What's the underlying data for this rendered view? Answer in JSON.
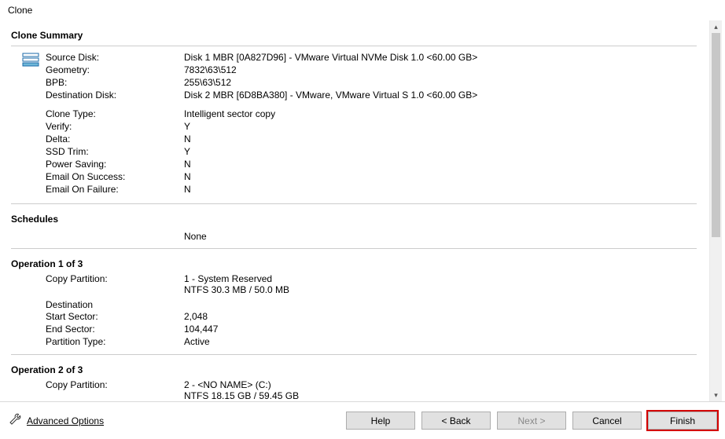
{
  "window": {
    "title": "Clone"
  },
  "summary": {
    "heading": "Clone Summary",
    "rows1": [
      {
        "label": "Source Disk:",
        "value": "Disk 1 MBR [0A827D96] - VMware Virtual NVMe Disk 1.0  <60.00 GB>"
      },
      {
        "label": "Geometry:",
        "value": "7832\\63\\512"
      },
      {
        "label": "BPB:",
        "value": "255\\63\\512"
      },
      {
        "label": "Destination Disk:",
        "value": "Disk 2 MBR [6D8BA380] - VMware,  VMware Virtual S 1.0  <60.00 GB>"
      }
    ],
    "rows2": [
      {
        "label": "Clone Type:",
        "value": "Intelligent sector copy"
      },
      {
        "label": "Verify:",
        "value": "Y"
      },
      {
        "label": "Delta:",
        "value": "N"
      },
      {
        "label": "SSD Trim:",
        "value": "Y"
      },
      {
        "label": "Power Saving:",
        "value": "N"
      },
      {
        "label": "Email On Success:",
        "value": "N"
      },
      {
        "label": "Email On Failure:",
        "value": "N"
      }
    ]
  },
  "schedules": {
    "heading": "Schedules",
    "value": "None"
  },
  "op1": {
    "heading": "Operation 1 of 3",
    "copy": {
      "label": "Copy Partition:",
      "line1": "1 - System Reserved",
      "line2": "NTFS 30.3 MB / 50.0 MB"
    },
    "destHeading": "Destination",
    "rows": [
      {
        "label": "Start Sector:",
        "value": "2,048"
      },
      {
        "label": "End Sector:",
        "value": "104,447"
      },
      {
        "label": "Partition Type:",
        "value": "Active"
      }
    ]
  },
  "op2": {
    "heading": "Operation 2 of 3",
    "copy": {
      "label": "Copy Partition:",
      "line1": "2 - <NO NAME> (C:)",
      "line2": "NTFS 18.15 GB / 59.45 GB"
    }
  },
  "footer": {
    "advanced": "Advanced Options",
    "help": "Help",
    "back": "< Back",
    "next": "Next >",
    "cancel": "Cancel",
    "finish": "Finish"
  }
}
